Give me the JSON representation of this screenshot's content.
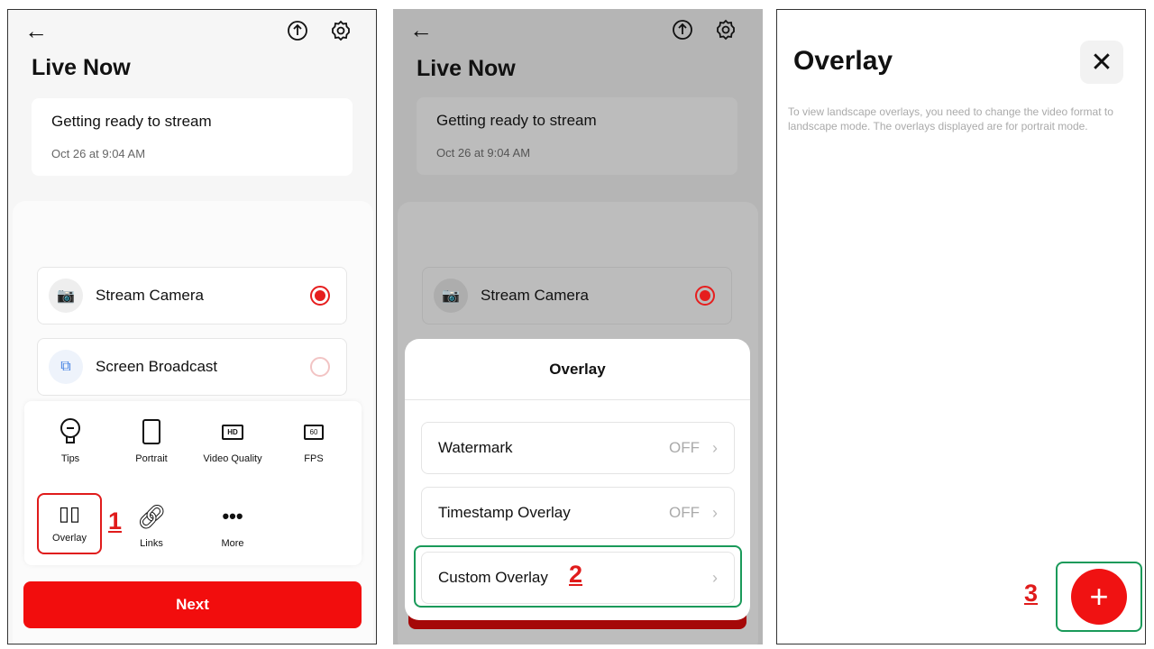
{
  "panel1": {
    "title": "Live Now",
    "stream_card": {
      "title": "Getting ready to stream",
      "date": "Oct 26 at 9:04 AM"
    },
    "options": [
      {
        "label": "Stream Camera",
        "selected": true
      },
      {
        "label": "Screen Broadcast",
        "selected": false
      }
    ],
    "tools": [
      {
        "label": "Tips",
        "icon": "lightbulb-icon"
      },
      {
        "label": "Portrait",
        "icon": "portrait-icon"
      },
      {
        "label": "Video Quality",
        "icon": "hd-icon",
        "glyph": "HD"
      },
      {
        "label": "FPS",
        "icon": "fps-icon",
        "glyph": "60"
      },
      {
        "label": "Overlay",
        "icon": "overlay-icon"
      },
      {
        "label": "Links",
        "icon": "link-icon"
      },
      {
        "label": "More",
        "icon": "more-icon"
      }
    ],
    "step": "1",
    "next_label": "Next"
  },
  "panel2": {
    "title": "Live Now",
    "stream_card": {
      "title": "Getting ready to stream",
      "date": "Oct 26 at 9:04 AM"
    },
    "option": "Stream Camera",
    "sheet": {
      "title": "Overlay",
      "rows": [
        {
          "label": "Watermark",
          "state": "OFF"
        },
        {
          "label": "Timestamp Overlay",
          "state": "OFF"
        },
        {
          "label": "Custom Overlay",
          "state": ""
        }
      ]
    },
    "step": "2"
  },
  "panel3": {
    "title": "Overlay",
    "note": "To view landscape overlays, you need to change the video format to landscape mode. The overlays displayed are for portrait mode.",
    "step": "3"
  },
  "colors": {
    "accent": "#f20d0d",
    "highlight_red": "#e01b1b",
    "highlight_green": "#1a9a5a"
  }
}
